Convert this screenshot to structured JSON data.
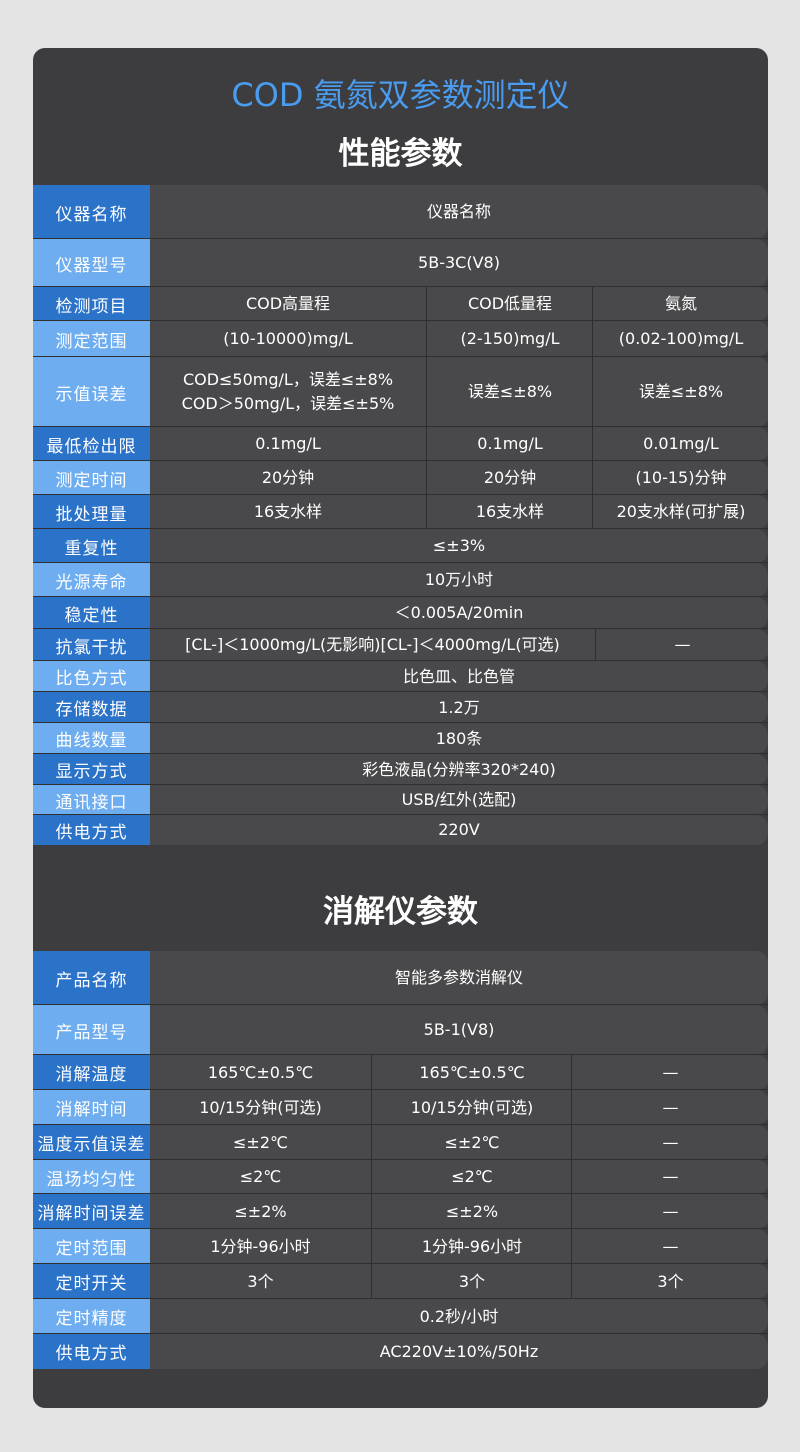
{
  "header": {
    "main_title": "COD 氨氮双参数测定仪",
    "section1_title": "性能参数",
    "section2_title": "消解仪参数"
  },
  "table1": [
    {
      "label": "仪器名称",
      "cells": [
        "仪器名称"
      ]
    },
    {
      "label": "仪器型号",
      "cells": [
        "5B-3C(V8)"
      ]
    },
    {
      "label": "检测项目",
      "cells": [
        "COD高量程",
        "COD低量程",
        "氨氮"
      ]
    },
    {
      "label": "测定范围",
      "cells": [
        "(10-10000)mg/L",
        "(2-150)mg/L",
        "(0.02-100)mg/L"
      ]
    },
    {
      "label": "示值误差",
      "cells": [
        "COD≤50mg/L，误差≤±8%\nCOD＞50mg/L，误差≤±5%",
        "误差≤±8%",
        "误差≤±8%"
      ]
    },
    {
      "label": "最低检出限",
      "cells": [
        "0.1mg/L",
        "0.1mg/L",
        "0.01mg/L"
      ]
    },
    {
      "label": "测定时间",
      "cells": [
        "20分钟",
        "20分钟",
        "(10-15)分钟"
      ]
    },
    {
      "label": "批处理量",
      "cells": [
        "16支水样",
        "16支水样",
        "20支水样(可扩展)"
      ]
    },
    {
      "label": "重复性",
      "cells": [
        "≤±3%"
      ]
    },
    {
      "label": "光源寿命",
      "cells": [
        "10万小时"
      ]
    },
    {
      "label": "稳定性",
      "cells": [
        "＜0.005A/20min"
      ]
    },
    {
      "label": "抗氯干扰",
      "cells": [
        "[CL-]＜1000mg/L(无影响)[CL-]＜4000mg/L(可选)",
        "—"
      ]
    },
    {
      "label": "比色方式",
      "cells": [
        "比色皿、比色管"
      ]
    },
    {
      "label": "存储数据",
      "cells": [
        "1.2万"
      ]
    },
    {
      "label": "曲线数量",
      "cells": [
        "180条"
      ]
    },
    {
      "label": "显示方式",
      "cells": [
        "彩色液晶(分辨率320*240)"
      ]
    },
    {
      "label": "通讯接口",
      "cells": [
        "USB/红外(选配)"
      ]
    },
    {
      "label": "供电方式",
      "cells": [
        "220V"
      ]
    }
  ],
  "table2": [
    {
      "label": "产品名称",
      "cells": [
        "智能多参数消解仪"
      ]
    },
    {
      "label": "产品型号",
      "cells": [
        "5B-1(V8)"
      ]
    },
    {
      "label": "消解温度",
      "cells": [
        "165℃±0.5℃",
        "165℃±0.5℃",
        "—"
      ]
    },
    {
      "label": "消解时间",
      "cells": [
        "10/15分钟(可选)",
        "10/15分钟(可选)",
        "—"
      ]
    },
    {
      "label": "温度示值误差",
      "cells": [
        "≤±2℃",
        "≤±2℃",
        "—"
      ]
    },
    {
      "label": "温场均匀性",
      "cells": [
        "≤2℃",
        "≤2℃",
        "—"
      ]
    },
    {
      "label": "消解时间误差",
      "cells": [
        "≤±2%",
        "≤±2%",
        "—"
      ]
    },
    {
      "label": "定时范围",
      "cells": [
        "1分钟-96小时",
        "1分钟-96小时",
        "—"
      ]
    },
    {
      "label": "定时开关",
      "cells": [
        "3个",
        "3个",
        "3个"
      ]
    },
    {
      "label": "定时精度",
      "cells": [
        "0.2秒/小时"
      ]
    },
    {
      "label": "供电方式",
      "cells": [
        "AC220V±10%/50Hz"
      ]
    }
  ],
  "colors": {
    "label_light": "#6eaef0",
    "label_dark": "#2b72c9",
    "title_accent": "#4a9cf0",
    "card_bg": "#3d3d3f",
    "cell_bg": "#49494b"
  }
}
